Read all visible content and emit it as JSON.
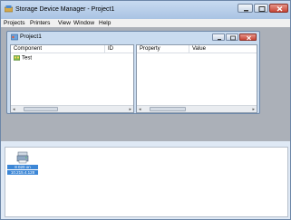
{
  "window": {
    "title": "Storage Device Manager - Project1",
    "controls": {
      "minimize": "minimize",
      "maximize": "maximize",
      "close": "close"
    }
  },
  "menu": [
    {
      "label": "Projects"
    },
    {
      "label": "Printers"
    },
    {
      "label": "View"
    },
    {
      "label": "Window"
    },
    {
      "label": "Help"
    }
  ],
  "project_window": {
    "title": "Project1",
    "left_pane": {
      "columns": [
        "Component",
        "ID"
      ],
      "items": [
        {
          "label": "Test",
          "icon": "group-icon"
        }
      ]
    },
    "right_pane": {
      "columns": [
        "Property",
        "Value"
      ]
    }
  },
  "devices": [
    {
      "name": "8 020 on",
      "address": "10.215.4.128",
      "selected": true,
      "icon": "printer-icon"
    }
  ],
  "colors": {
    "title_bar": "#b8cfeb",
    "mdi_background": "#abb0b8",
    "selection": "#3d87d6",
    "close_button": "#c74536"
  }
}
